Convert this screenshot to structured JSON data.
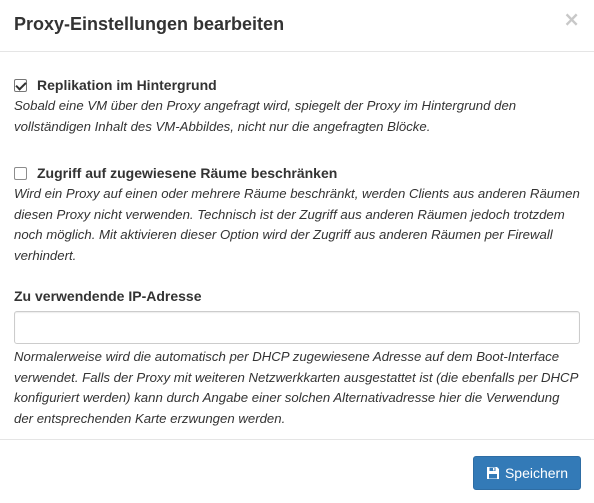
{
  "dialog": {
    "title": "Proxy-Einstellungen bearbeiten",
    "close_symbol": "×"
  },
  "replication": {
    "checked": true,
    "label": "Replikation im Hintergrund",
    "help": "Sobald eine VM über den Proxy angefragt wird, spiegelt der Proxy im Hintergrund den vollständigen Inhalt des VM-Abbildes, nicht nur die angefragten Blöcke."
  },
  "restrict_access": {
    "checked": false,
    "label": "Zugriff auf zugewiesene Räume beschränken",
    "help": "Wird ein Proxy auf einen oder mehrere Räume beschränkt, werden Clients aus anderen Räumen diesen Proxy nicht verwenden. Technisch ist der Zugriff aus anderen Räumen jedoch trotzdem noch möglich. Mit aktivieren dieser Option wird der Zugriff aus anderen Räumen per Firewall verhindert."
  },
  "ip_address": {
    "label": "Zu verwendende IP-Adresse",
    "value": "",
    "help": "Normalerweise wird die automatisch per DHCP zugewiesene Adresse auf dem Boot-Interface verwendet. Falls der Proxy mit weiteren Netzwerkkarten ausgestattet ist (die ebenfalls per DHCP konfiguriert werden) kann durch Angabe einer solchen Alternativadresse hier die Verwendung der entsprechenden Karte erzwungen werden."
  },
  "footer": {
    "save_label": "Speichern",
    "save_icon": "floppy-disk-icon"
  },
  "colors": {
    "primary": "#337ab7",
    "text": "#333333",
    "border": "#e5e5e5"
  }
}
